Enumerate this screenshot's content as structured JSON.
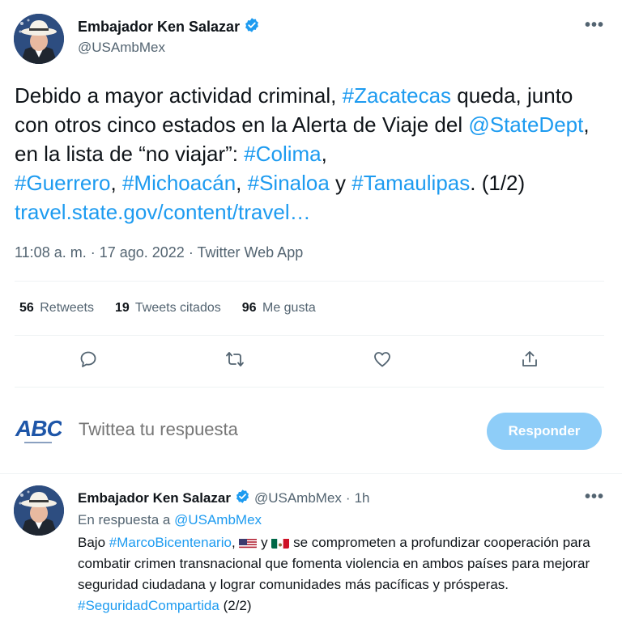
{
  "main_tweet": {
    "author_name": "Embajador Ken Salazar",
    "handle": "@USAmbMex",
    "more_label": "•••",
    "text": {
      "p1": "Debido a mayor actividad criminal, ",
      "hashtag_zacatecas": "#Zacatecas",
      "p2": " queda, junto con otros cinco estados en la Alerta de Viaje del ",
      "mention_statedept": "@StateDept",
      "p3": ", en la lista de “no viajar”: ",
      "hashtag_colima": "#Colima",
      "p4": ", ",
      "hashtag_guerrero": "#Guerrero",
      "p5": ", ",
      "hashtag_michoacan": "#Michoacán",
      "p6": ", ",
      "hashtag_sinaloa": "#Sinaloa",
      "p7": " y ",
      "hashtag_tamaulipas": "#Tamaulipas",
      "p8": ". (1/2) ",
      "link": "travel.state.gov/content/travel…"
    },
    "meta": "11:08 a. m. · 17 ago. 2022 · Twitter Web App",
    "stats": {
      "retweets_count": "56",
      "retweets_label": "Retweets",
      "quotes_count": "19",
      "quotes_label": "Tweets citados",
      "likes_count": "96",
      "likes_label": "Me gusta"
    },
    "actions": [
      "reply-icon",
      "retweet-icon",
      "like-icon",
      "share-icon"
    ]
  },
  "reply_box": {
    "logo_text": "ABC",
    "placeholder": "Twittea tu respuesta",
    "button_label": "Responder"
  },
  "second_tweet": {
    "author_name": "Embajador Ken Salazar",
    "handle": "@USAmbMex",
    "dot": "·",
    "time": "1h",
    "more_label": "•••",
    "reply_prefix": "En respuesta a ",
    "reply_handle": "@USAmbMex",
    "text": {
      "p1": "Bajo ",
      "hashtag_marco": "#MarcoBicentenario",
      "p2": ", ",
      "p3": " y ",
      "p4": " se comprometen a profundizar cooperación para combatir crimen transnacional que fomenta violencia en ambos países para mejorar seguridad ciudadana y lograr comunidades más pacíficas y prósperas. ",
      "hashtag_seguridad": "#SeguridadCompartida",
      "p5": " (2/2)"
    }
  },
  "colors": {
    "link": "#1d9bf0",
    "secondary_text": "#536471",
    "reply_button": "#8ecdf8",
    "verified": "#1d9bf0"
  }
}
